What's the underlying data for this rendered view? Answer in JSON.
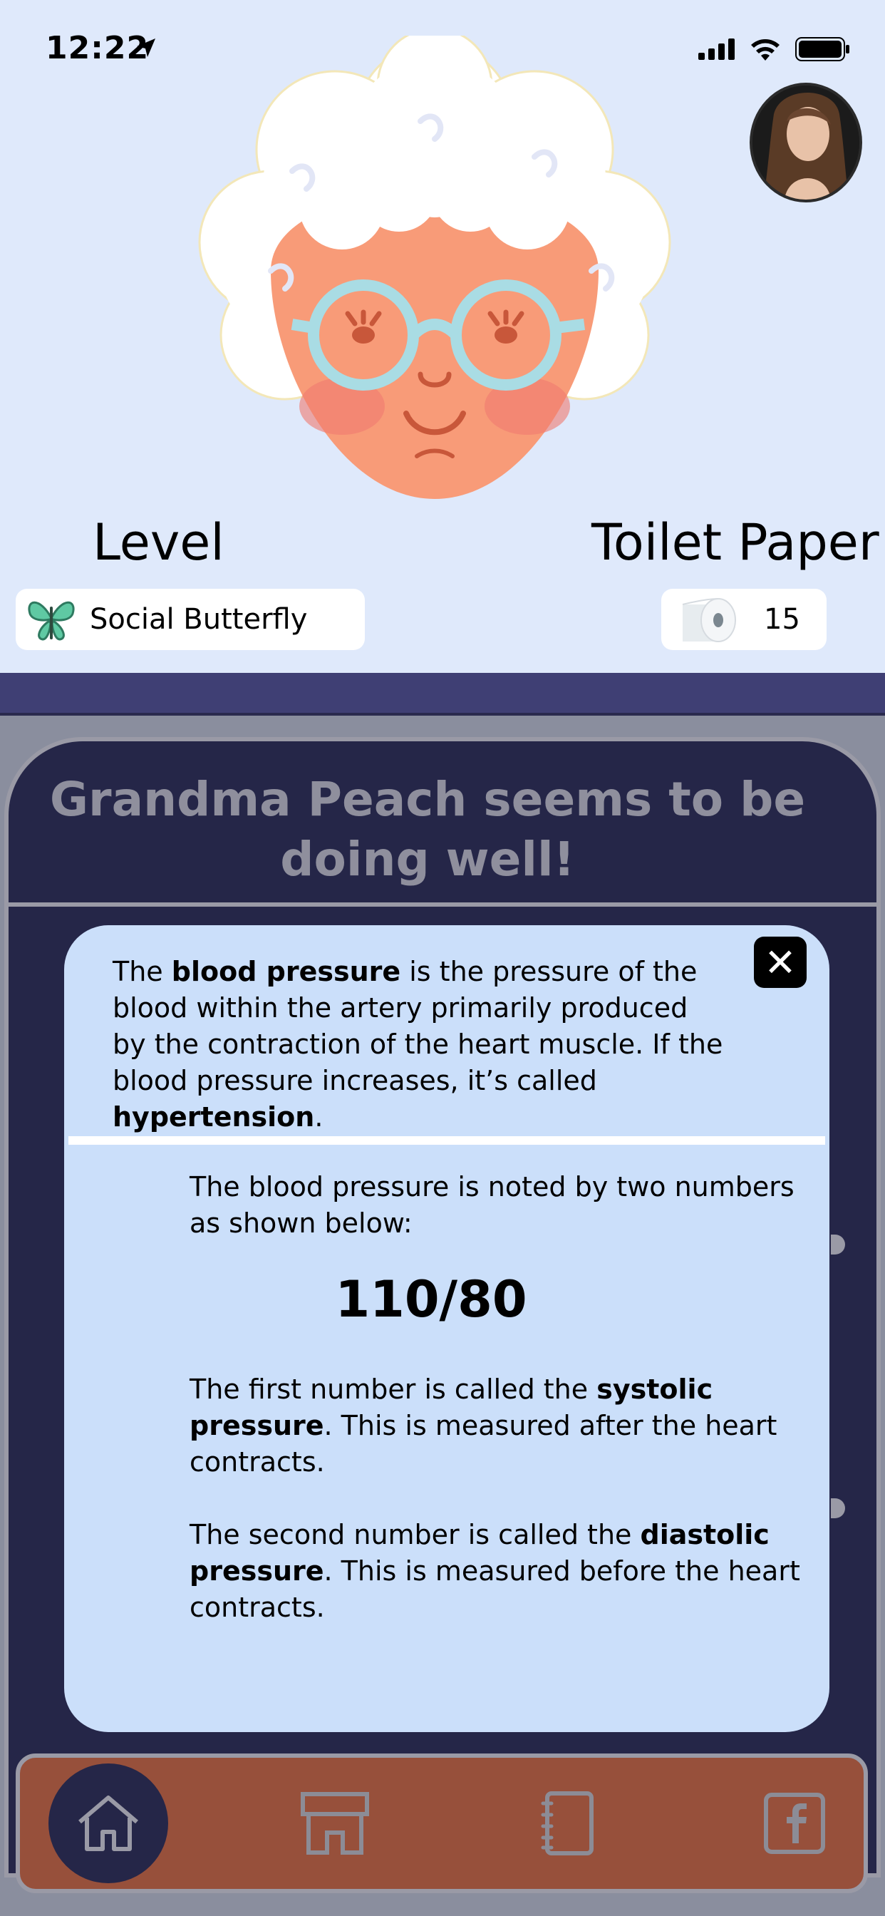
{
  "status": {
    "time": "12:22",
    "icons": [
      "location-arrow-icon",
      "signal-icon",
      "wifi-icon",
      "battery-icon"
    ]
  },
  "character": {
    "avatar": "profile-photo"
  },
  "stats": {
    "level_label": "Level",
    "level_value": "Social Butterfly",
    "level_icon": "butterfly-icon",
    "tp_label": "Toilet Paper",
    "tp_value": "15",
    "tp_icon": "toilet-paper-icon"
  },
  "card": {
    "title": "Grandma Peach seems to be doing well!"
  },
  "modal": {
    "p1": [
      "The ",
      "blood pressure",
      " is the pressure of the blood within the artery primarily produced by the contraction of the heart muscle.  If the blood pressure increases, it’s called ",
      "hypertension",
      "."
    ],
    "p2": "The blood pressure is noted by two numbers as shown below:",
    "bp": "110/80",
    "p3": [
      "The first number is called the ",
      "systolic pressure",
      ".  This is measured after the heart contracts."
    ],
    "p4": [
      "The second number is called the ",
      "diastolic pressure",
      ".  This is measured before the heart contracts."
    ],
    "close_icon": "close-icon"
  },
  "nav": {
    "items": [
      "home-icon",
      "store-icon",
      "notebook-icon",
      "facebook-icon"
    ]
  },
  "colors": {
    "background": "#dfe9fb",
    "stripe": "#3f3f74",
    "card": "#252648",
    "modal": "#cbdffa",
    "nav": "#97503b"
  }
}
